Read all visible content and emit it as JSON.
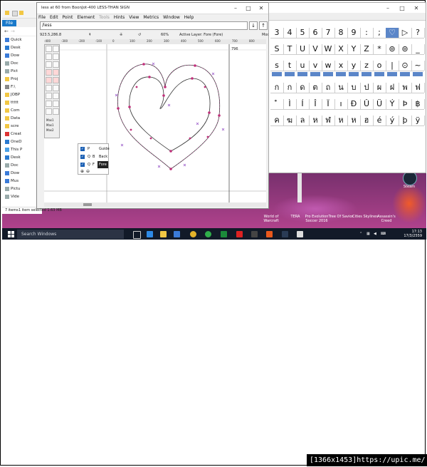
{
  "explorer": {
    "file_tab": "File",
    "quick": "Quick",
    "tree": [
      "Desk",
      "Dow",
      "Doc",
      "Pict",
      "Proj",
      "F:\\",
      "JOBP",
      "ttttt",
      "Com",
      "Data",
      "scre",
      "Creat",
      "OneD",
      "This P",
      "Desk",
      "Doc",
      "Dow",
      "Mus",
      "Pictu",
      "Vide"
    ],
    "status": "7 items"
  },
  "ff": {
    "title": "less at 60 from BoonJot-400 LESS-THAN SIGN",
    "menu": [
      "File",
      "Edit",
      "Point",
      "Element",
      "Tools",
      "Hints",
      "View",
      "Metrics",
      "Window",
      "Help"
    ],
    "search_value": "/less",
    "search_btn_down": "↓",
    "search_btn_up": "↑",
    "coords": "923.5,286.8",
    "zoom": "60%",
    "active_layer": "Active Layer: Fore (Fore)",
    "mode_label": "Mode",
    "ruler": [
      "-400",
      "-300",
      "-200",
      "-100",
      "0",
      "100",
      "200",
      "300",
      "400",
      "500",
      "600",
      "700",
      "800"
    ],
    "value_796": "796",
    "layers": [
      {
        "k1": "P",
        "k2": "",
        "name": "Guide"
      },
      {
        "k1": "Q",
        "k2": "B",
        "name": "Back"
      },
      {
        "k1": "Q",
        "k2": "F",
        "name": "Fore"
      }
    ],
    "minilayers": [
      "Mas1",
      "Mas1",
      "Mas2"
    ],
    "status_items": "1 item selected  1.63 MB"
  },
  "glyphs": {
    "rows": [
      [
        "",
        "",
        "",
        "",
        "",
        "",
        "",
        "<",
        "=",
        ">",
        "?"
      ],
      [
        "3",
        "4",
        "5",
        "6",
        "7",
        "8",
        "9",
        ":",
        ";",
        "♡",
        "▷",
        "?"
      ],
      [
        "S",
        "T",
        "U",
        "V",
        "W",
        "X",
        "Y",
        "Z",
        "*",
        "⊚",
        "_"
      ],
      [
        "s",
        "t",
        "u",
        "v",
        "w",
        "x",
        "y",
        "z",
        "o",
        "|",
        "⊙",
        "~"
      ],
      [
        "",
        "",
        "",
        "",
        "",
        "",
        "",
        "",
        "",
        "",
        "",
        ""
      ],
      [
        "ฉ",
        "ฉ",
        "ด",
        "ต",
        "ถ",
        "ท",
        "ธ",
        "น",
        "บ",
        "ป",
        "ผ",
        "ฝ",
        "พ"
      ],
      [
        "ั",
        "ำ",
        "ิ",
        "ี",
        "ึ",
        "ื",
        "Û",
        "Ü",
        "Ý",
        "Þ",
        "ß"
      ],
      [
        "ฅ",
        "ฆ",
        "ฃ",
        "ๆ",
        "ฌ",
        "ฎ",
        "ฐ",
        "ฑ",
        "ณ",
        "ý",
        "þ",
        "ÿ"
      ]
    ],
    "rows_rendered": [
      [
        "3",
        "4",
        "5",
        "6",
        "7",
        "8",
        "9",
        ":",
        ";",
        "♡",
        "▷",
        "?"
      ],
      [
        "S",
        "T",
        "U",
        "V",
        "W",
        "X",
        "Y",
        "Z",
        "*",
        "⊚",
        "⊚",
        "_"
      ],
      [
        "s",
        "t",
        "u",
        "v",
        "w",
        "x",
        "y",
        "z",
        "o",
        "|",
        "⊙",
        "~"
      ],
      [
        "ก",
        "ก",
        "ด",
        "ต",
        "ถ",
        "น",
        "บ",
        "ป",
        "ผ",
        "ฝ",
        "พ",
        "ฟ"
      ],
      [
        "ํ",
        "Ì",
        "Í",
        "Î",
        "Ï",
        "ı",
        "Ð",
        "Û",
        "Ü",
        "Ý",
        "Þ",
        "฿"
      ],
      [
        "ค",
        "ฆ",
        "ล",
        "ห",
        "ฬ",
        "ห",
        "ห",
        "ฮ",
        "é",
        "ý",
        "þ",
        "ÿ"
      ]
    ]
  },
  "desktop": {
    "labels": [
      "World of Warcraft",
      "TERA",
      "Pro Evolution Soccer 2016",
      "Tree Of Savior",
      "Cities Skylines",
      "Assassin's Creed"
    ],
    "steam": "Steam"
  },
  "taskbar": {
    "search": "Search Windows",
    "time": "17:13",
    "date": "17/3/2559"
  },
  "badge": "[1366x1453]https://upic.me/",
  "colors": {
    "accent": "#1979ca",
    "selection": "#5b86c8",
    "outline": "#b03a8c"
  }
}
